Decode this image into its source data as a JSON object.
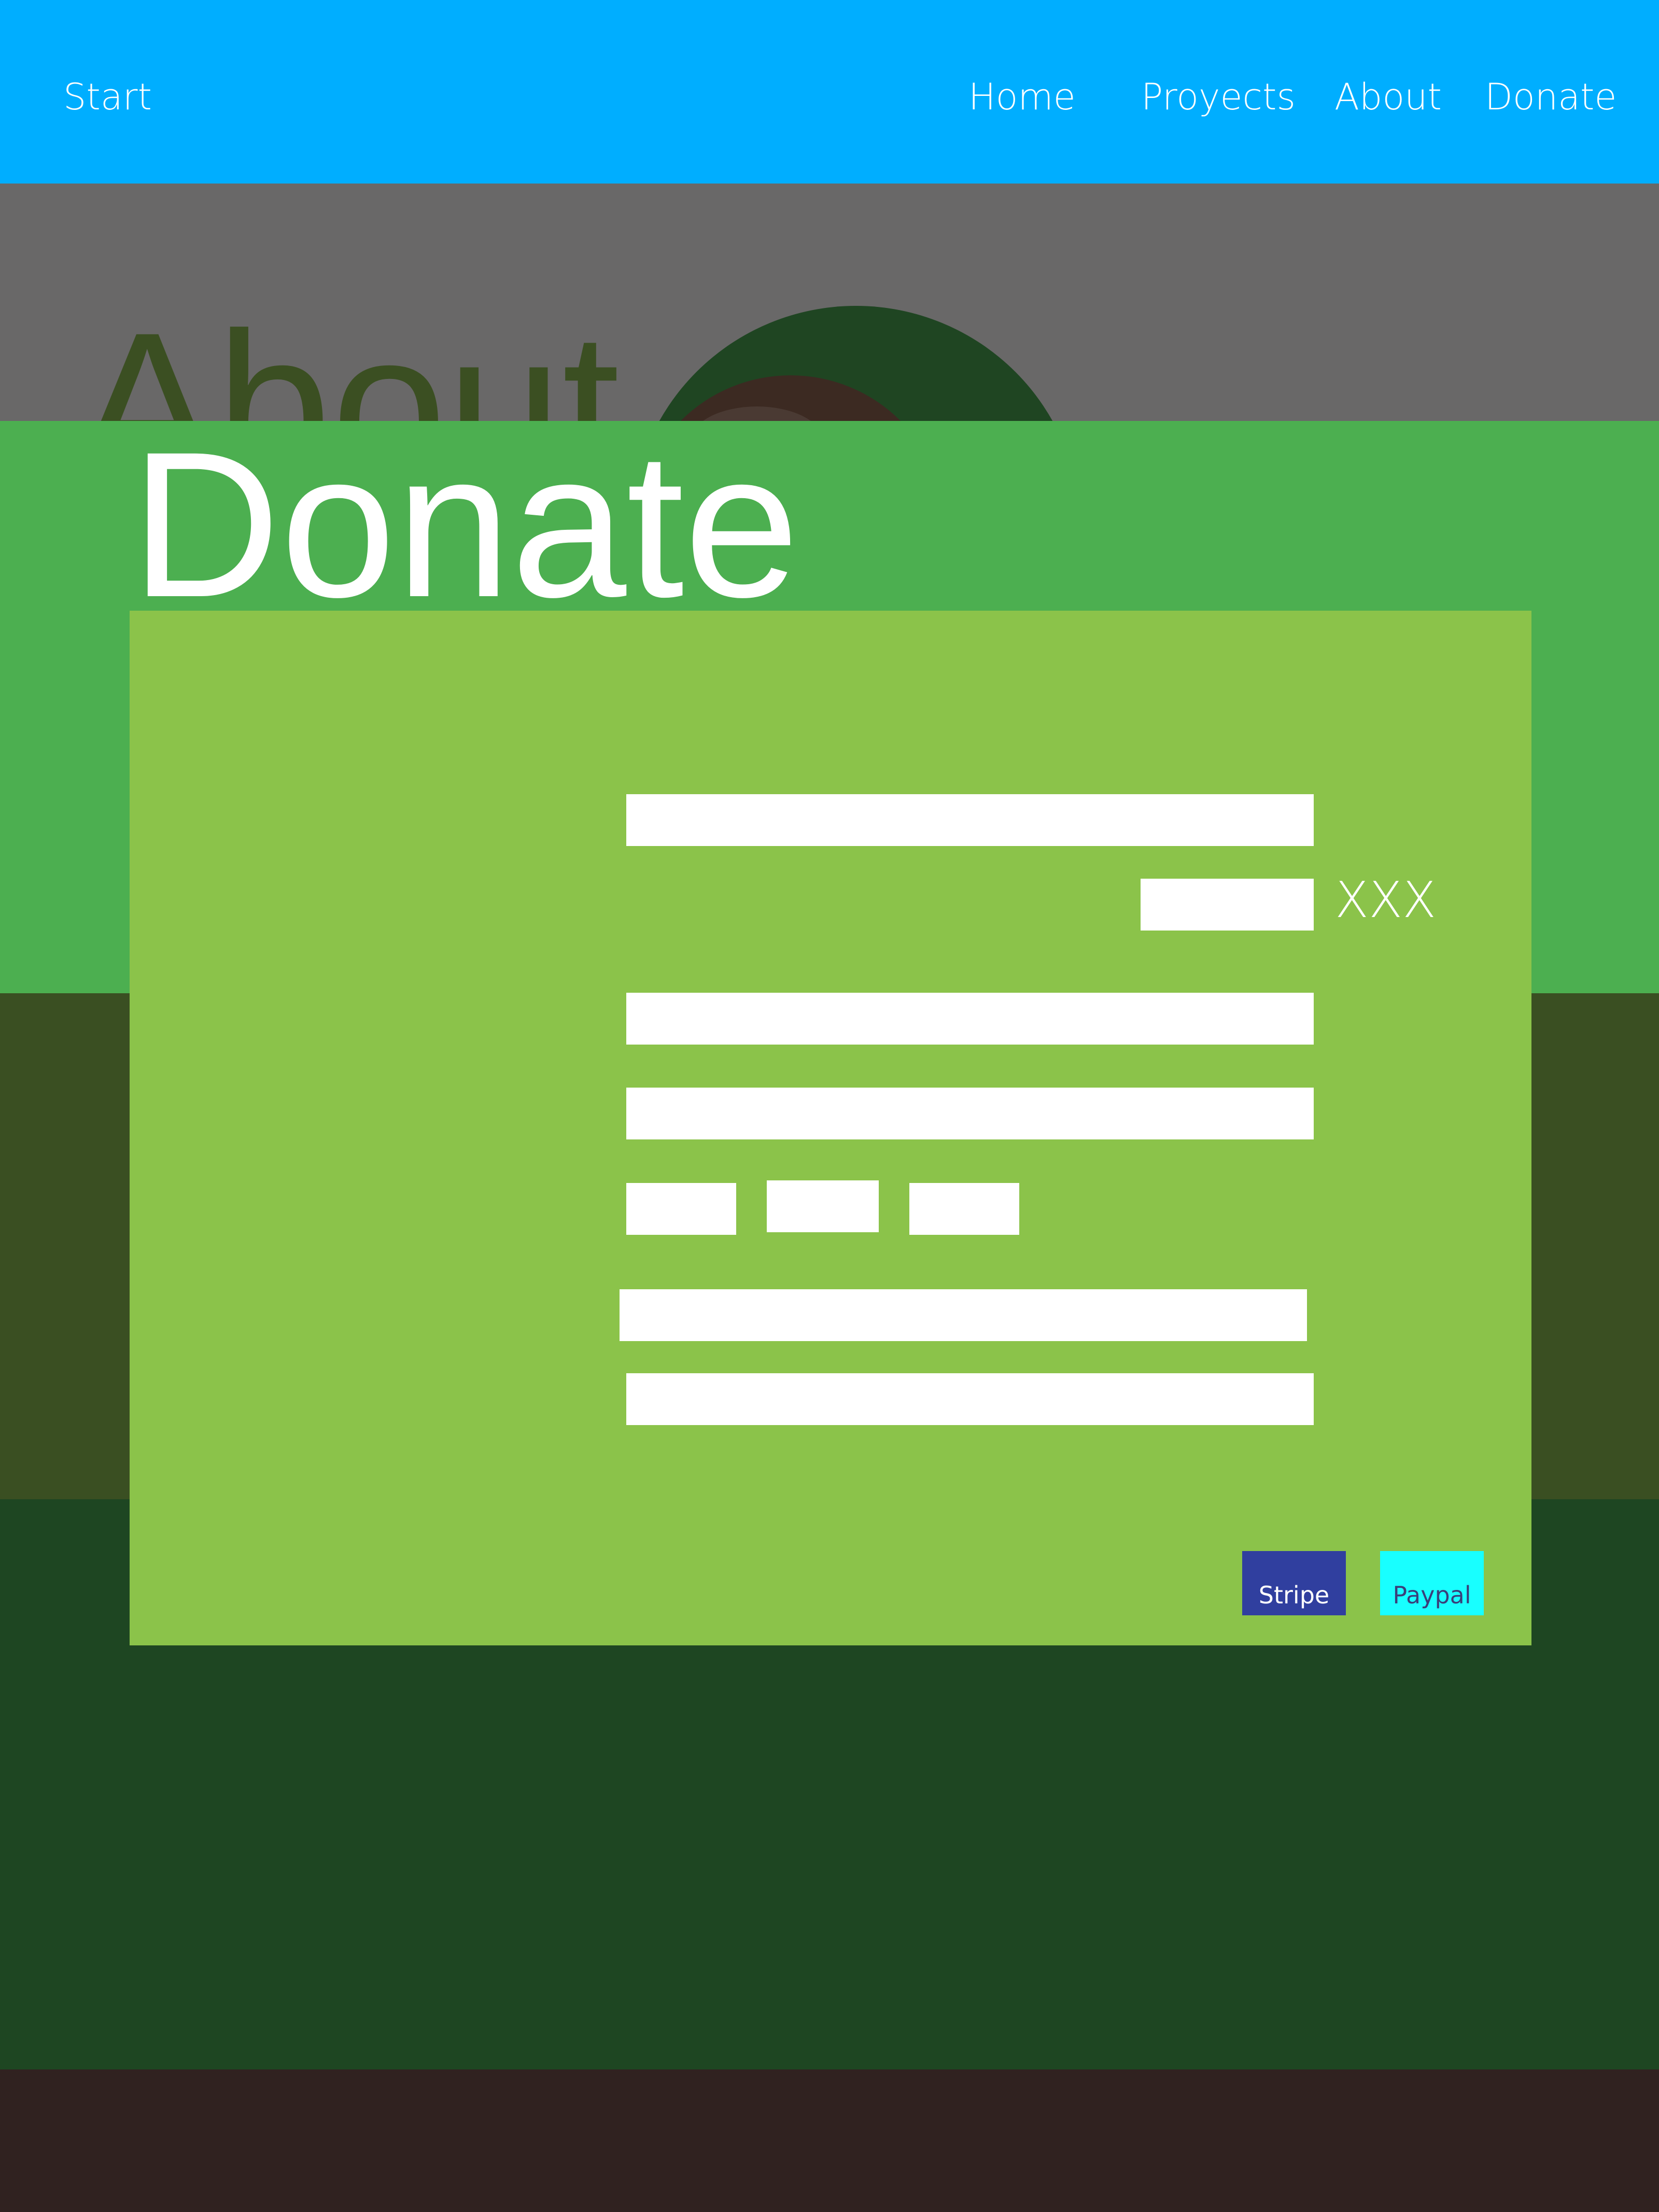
{
  "nav": {
    "brand": "Start",
    "links": [
      "Home",
      "Proyects",
      "About",
      "Donate"
    ]
  },
  "background": {
    "about_heading": "About"
  },
  "donate": {
    "title": "Donate",
    "amount_suffix": "XXX",
    "fields": [
      {
        "name": "field-1",
        "value": ""
      },
      {
        "name": "amount",
        "value": ""
      },
      {
        "name": "field-3",
        "value": ""
      },
      {
        "name": "field-4",
        "value": ""
      },
      {
        "name": "field-5a",
        "value": ""
      },
      {
        "name": "field-5b",
        "value": ""
      },
      {
        "name": "field-5c",
        "value": ""
      },
      {
        "name": "field-6",
        "value": ""
      },
      {
        "name": "field-7",
        "value": ""
      }
    ],
    "payment": {
      "stripe_label": "Stripe",
      "paypal_label": "Paypal"
    }
  },
  "colors": {
    "nav_bg": "#00AEFF",
    "section_green": "#4CAF50",
    "panel_green": "#8BC34A",
    "stripe": "#303F9F",
    "paypal": "#18FFFF"
  }
}
